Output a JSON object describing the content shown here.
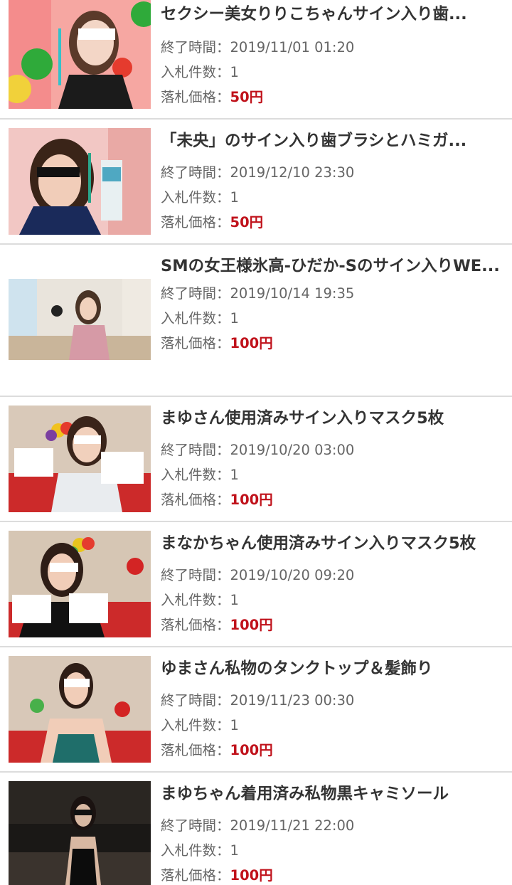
{
  "labels": {
    "end_time": "終了時間：",
    "bid_count": "入札件数：",
    "price": "落札価格："
  },
  "colors": {
    "price": "#c0121b",
    "divider": "#dcdcdc"
  },
  "items": [
    {
      "title": "セクシー美女りりこちゃんサイン入り歯...",
      "end_time": "2019/11/01 01:20",
      "bid_count": "1",
      "price": "50円",
      "thumb": "woman-with-toothbrush-photo"
    },
    {
      "title": "「未央」のサイン入り歯ブラシとハミガ...",
      "end_time": "2019/12/10 23:30",
      "bid_count": "1",
      "price": "50円",
      "thumb": "woman-with-toothpaste-photo"
    },
    {
      "title": "SMの女王様氷高-ひだか-Sのサイン入りWE...",
      "end_time": "2019/10/14 19:35",
      "bid_count": "1",
      "price": "100円",
      "thumb": "woman-in-room-photo"
    },
    {
      "title": "まゆさん使用済みサイン入りマスク5枚",
      "end_time": "2019/10/20 03:00",
      "bid_count": "1",
      "price": "100円",
      "thumb": "woman-holding-masks-photo"
    },
    {
      "title": "まなかちゃん使用済みサイン入りマスク5枚",
      "end_time": "2019/10/20 09:20",
      "bid_count": "1",
      "price": "100円",
      "thumb": "woman-holding-masks-photo"
    },
    {
      "title": "ゆまさん私物のタンクトップ＆髪飾り",
      "end_time": "2019/11/23 00:30",
      "bid_count": "1",
      "price": "100円",
      "thumb": "woman-in-tank-top-photo"
    },
    {
      "title": "まゆちゃん着用済み私物黒キャミソール",
      "end_time": "2019/11/21 22:00",
      "bid_count": "1",
      "price": "100円",
      "thumb": "woman-in-black-camisole-photo"
    }
  ]
}
